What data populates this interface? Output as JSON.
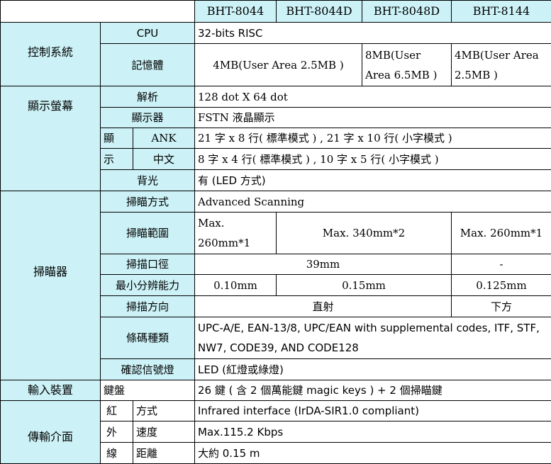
{
  "header": {
    "models": [
      "BHT-8044",
      "BHT-8044D",
      "BHT-8048D",
      "BHT-8144"
    ]
  },
  "categories": {
    "control": "控制系統",
    "display": "顯示螢幕",
    "scanner": "掃瞄器",
    "input": "輸入裝置",
    "transfer": "傳輸介面"
  },
  "rows": {
    "cpu": {
      "label": "CPU",
      "value": "32-bits RISC"
    },
    "memory": {
      "label": "記憶體",
      "v1": "4MB(User Area 2.5MB )",
      "v2": "8MB(User Area 6.5MB )",
      "v3": "4MB(User Area 2.5MB )"
    },
    "resolution": {
      "label": "解析",
      "value": "128 dot X 64 dot"
    },
    "display": {
      "label": "顯示器",
      "value": "FSTN  液晶顯示"
    },
    "display_mode": {
      "label_a": "顯",
      "label_b": "示",
      "ank_label": "ANK",
      "ank_value": "21 字  x    8 行(  標準模式 ) , 21 字  x    10 行(  小字模式  )",
      "zh_label": "中文",
      "zh_value": "8 字  x    4 行(  標準模式 ) , 10 字  x    5 行(  小字模式  )"
    },
    "backlight": {
      "label": "背光",
      "value": "有 (LED 方式)"
    },
    "scan_method": {
      "label": "掃瞄方式",
      "value": "Advanced Scanning"
    },
    "scan_range": {
      "label": "掃瞄範圍",
      "v1": "Max. 260mm*1",
      "v2": "Max. 340mm*2",
      "v3": "Max. 260mm*1"
    },
    "aperture": {
      "label": "掃描口徑",
      "v1": "39mm",
      "v2": "-"
    },
    "min_resolution": {
      "label": "最小分辨能力",
      "v1": "0.10mm",
      "v2": "0.15mm",
      "v3": "0.125mm"
    },
    "scan_direction": {
      "label": "掃描方向",
      "v1": "直射",
      "v2": "下方"
    },
    "barcode": {
      "label": "條碼種類",
      "value": "UPC-A/E, EAN-13/8, UPC/EAN with supplemental codes, ITF, STF, NW7, CODE39, AND CODE128"
    },
    "confirm": {
      "label": "確認信號燈",
      "value": "LED (紅燈或綠燈)"
    },
    "keyboard": {
      "label": "鍵盤",
      "value": "26  鍵  (  含 2 個萬能鍵  magic keys ) + 2  個掃瞄鍵"
    },
    "ir": {
      "label_a": "紅",
      "label_b": "外",
      "label_c": "線",
      "method_label": "方式",
      "method_value": "Infrared interface (IrDA-SIR1.0 compliant)",
      "speed_label": "速度",
      "speed_value": "Max.115.2 Kbps",
      "distance_label": "距離",
      "distance_value": "大約  0.15 m"
    }
  }
}
